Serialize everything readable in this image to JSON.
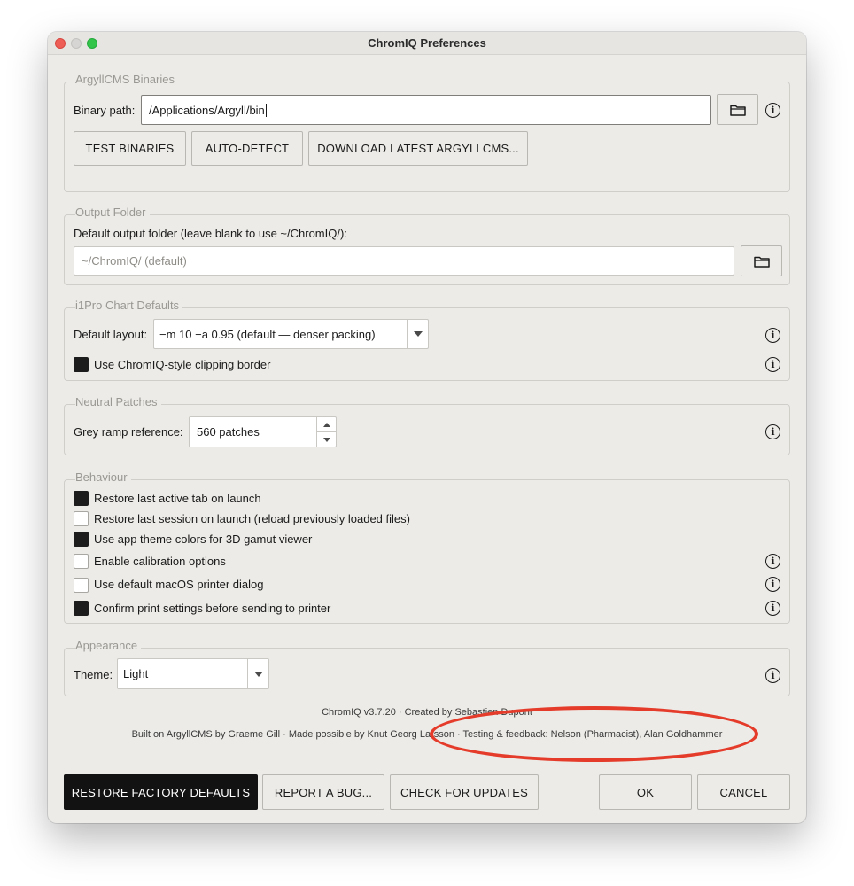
{
  "window": {
    "title": "ChromIQ Preferences"
  },
  "argyll": {
    "group_label": "ArgyllCMS Binaries",
    "binary_path_label": "Binary path:",
    "binary_path_value": "/Applications/Argyll/bin",
    "buttons": {
      "test": "TEST BINARIES",
      "auto_detect": "AUTO-DETECT",
      "download": "DOWNLOAD LATEST ARGYLLCMS..."
    }
  },
  "output": {
    "group_label": "Output Folder",
    "description": "Default output folder (leave blank to use ~/ChromIQ/):",
    "placeholder": "~/ChromIQ/  (default)"
  },
  "i1pro": {
    "group_label": "i1Pro Chart Defaults",
    "layout_label": "Default layout:",
    "layout_value": "−m 10  −a 0.95  (default — denser packing)",
    "clipping_label": "Use ChromIQ-style clipping border",
    "clipping_checked": true
  },
  "neutral": {
    "group_label": "Neutral Patches",
    "ramp_label": "Grey ramp reference:",
    "ramp_value": "560 patches"
  },
  "behaviour": {
    "group_label": "Behaviour",
    "items": [
      {
        "label": "Restore last active tab on launch",
        "checked": true
      },
      {
        "label": "Restore last session on launch (reload previously loaded files)",
        "checked": false
      },
      {
        "label": "Use app theme colors for 3D gamut viewer",
        "checked": true
      },
      {
        "label": "Enable calibration options",
        "checked": false
      },
      {
        "label": "Use default macOS printer dialog",
        "checked": false
      },
      {
        "label": "Confirm print settings before sending to printer",
        "checked": true
      }
    ]
  },
  "appearance": {
    "group_label": "Appearance",
    "theme_label": "Theme:",
    "theme_value": "Light"
  },
  "credits": {
    "line1": "ChromIQ v3.7.20 · Created by Sebastien Dupont",
    "line2": "Built on ArgyllCMS by Graeme Gill · Made possible by Knut Georg Larsson · Testing & feedback: Nelson (Pharmacist), Alan Goldhammer"
  },
  "footer": {
    "restore": "RESTORE FACTORY DEFAULTS",
    "report": "REPORT A BUG...",
    "updates": "CHECK FOR UPDATES",
    "ok": "OK",
    "cancel": "CANCEL"
  },
  "colors": {
    "accent": "#121212",
    "window_bg": "#ecebe7",
    "annotation": "#e43b2a"
  },
  "icons": {
    "folder": "folder-icon",
    "info": "info-icon",
    "dropdown": "chevron-down-icon"
  }
}
